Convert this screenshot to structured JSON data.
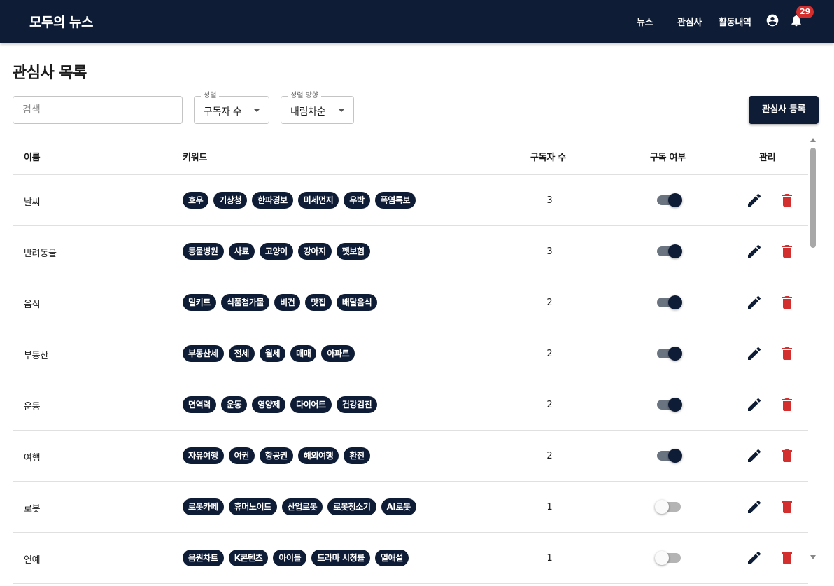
{
  "header": {
    "brand": "모두의 뉴스",
    "nav": {
      "news": "뉴스",
      "interests": "관심사",
      "activity": "활동내역"
    },
    "notification_count": "29",
    "icons": {
      "account": "account-circle-icon",
      "notifications": "bell-icon"
    }
  },
  "page": {
    "title": "관심사 목록"
  },
  "controls": {
    "search_placeholder": "검색",
    "search_value": "",
    "sort": {
      "label": "정렬",
      "value": "구독자 수"
    },
    "order": {
      "label": "정렬 방향",
      "value": "내림차순"
    },
    "register_label": "관심사 등록"
  },
  "table": {
    "columns": {
      "name": "이름",
      "keywords": "키워드",
      "subscribers": "구독자 수",
      "subscribed": "구독 여부",
      "manage": "관리"
    },
    "rows": [
      {
        "name": "날씨",
        "keywords": [
          "호우",
          "기상청",
          "한파경보",
          "미세먼지",
          "우박",
          "폭염특보"
        ],
        "subscribers": "3",
        "subscribed": true
      },
      {
        "name": "반려동물",
        "keywords": [
          "동물병원",
          "사료",
          "고양이",
          "강아지",
          "펫보험"
        ],
        "subscribers": "3",
        "subscribed": true
      },
      {
        "name": "음식",
        "keywords": [
          "밀키트",
          "식품첨가물",
          "비건",
          "맛집",
          "배달음식"
        ],
        "subscribers": "2",
        "subscribed": true
      },
      {
        "name": "부동산",
        "keywords": [
          "부동산세",
          "전세",
          "월세",
          "매매",
          "아파트"
        ],
        "subscribers": "2",
        "subscribed": true
      },
      {
        "name": "운동",
        "keywords": [
          "면역력",
          "운동",
          "영양제",
          "다이어트",
          "건강검진"
        ],
        "subscribers": "2",
        "subscribed": true
      },
      {
        "name": "여행",
        "keywords": [
          "자유여행",
          "여권",
          "항공권",
          "해외여행",
          "환전"
        ],
        "subscribers": "2",
        "subscribed": true
      },
      {
        "name": "로봇",
        "keywords": [
          "로봇카페",
          "휴머노이드",
          "산업로봇",
          "로봇청소기",
          "AI로봇"
        ],
        "subscribers": "1",
        "subscribed": false
      },
      {
        "name": "연예",
        "keywords": [
          "음원차트",
          "K콘텐츠",
          "아이돌",
          "드라마 시청률",
          "열애설"
        ],
        "subscribers": "1",
        "subscribed": false
      }
    ]
  },
  "colors": {
    "navy": "#0f1c36",
    "danger": "#d32f2f",
    "badge": "#d32f2f"
  }
}
